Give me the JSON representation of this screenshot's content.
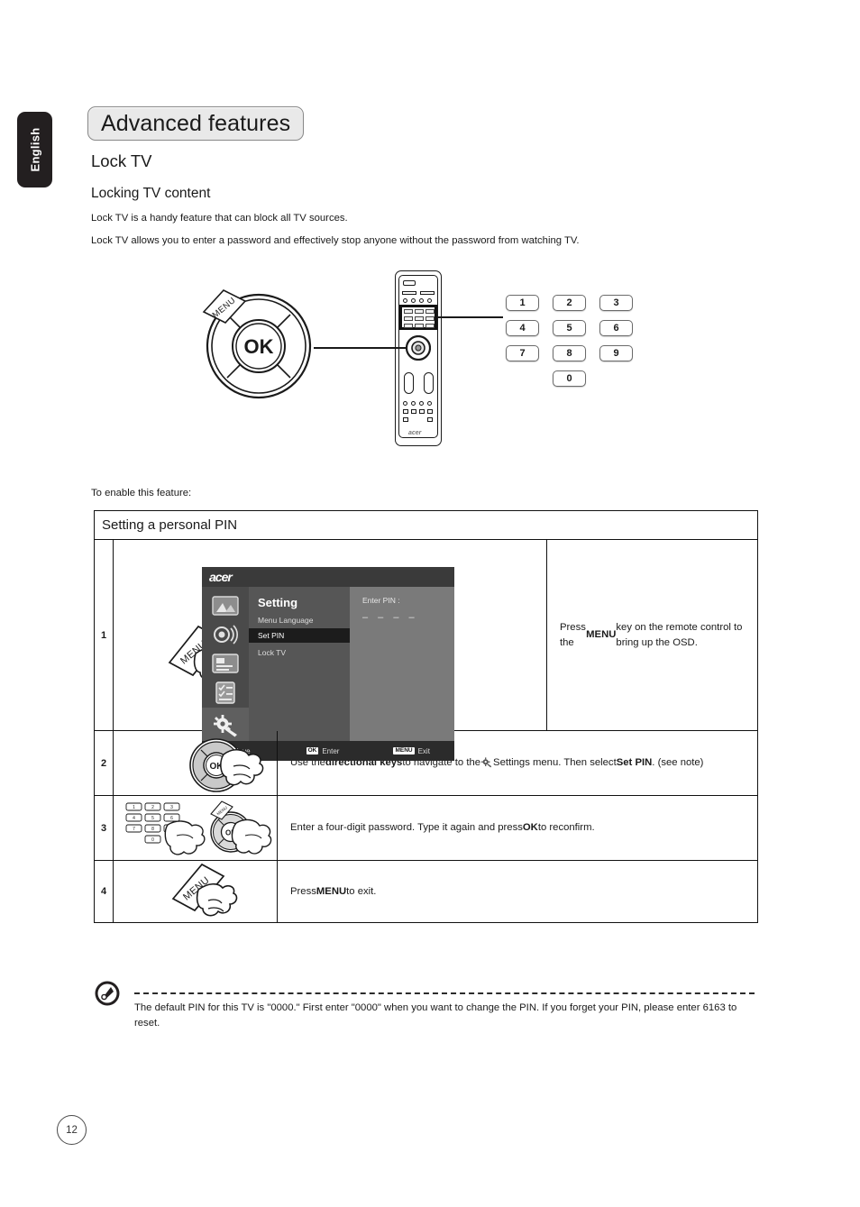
{
  "sidebar_tab": {
    "label": "English"
  },
  "heading": {
    "chip_title": "Advanced features",
    "h2": "Lock TV",
    "h3": "Locking TV content"
  },
  "intro": {
    "para1": "Lock TV is a handy feature that can block all TV sources.",
    "para2": "Lock TV allows you to enter a password and effectively stop anyone without the password from watching TV.",
    "enable_line": "To enable this feature:"
  },
  "hero_diagram": {
    "menu_tag_label": "MENU",
    "ok_label": "OK",
    "numpad_keys": [
      "1",
      "2",
      "3",
      "4",
      "5",
      "6",
      "7",
      "8",
      "9",
      "0"
    ]
  },
  "procedure": {
    "title": "Setting a personal PIN",
    "steps": [
      {
        "num": "1",
        "text_html": "Press the <b>MENU</b> key on the remote control to bring up the OSD.",
        "illustration": "hand-pressing-menu-key"
      },
      {
        "num": "2",
        "text_html": "Use the <b>directional keys</b> to navigate to the <span class=\"gear-inline\" data-name=\"settings-gear-icon\"><svg viewBox=\"0 0 20 20\" width=\"14\" height=\"13\"><g fill=\"#555\"><circle cx=\"8\" cy=\"8\" r=\"4.6\"/><circle cx=\"8\" cy=\"8\" r=\"1.8\" fill=\"#fff\"/><rect x=\"7\" y=\"0.6\" width=\"2\" height=\"3\"/><rect x=\"7\" y=\"12.4\" width=\"2\" height=\"3\"/><rect x=\"0.6\" y=\"7\" width=\"3\" height=\"2\"/><rect x=\"12.4\" y=\"7\" width=\"3\" height=\"2\"/><path d=\"M11.5 11 L18 15.5 L16.5 17.5 L10.5 12.5 Z\"/></g></svg></span> Settings menu. Then select <b>Set PIN</b>. (see note)",
        "illustration": "hand-pressing-ok-wheel"
      },
      {
        "num": "3",
        "text_html": "Enter a four-digit password. Type it again and press <b>OK</b> to reconfirm.",
        "illustration": "hand-pressing-numpad-and-ok"
      },
      {
        "num": "4",
        "text_html": "Press <b>MENU</b> to exit.",
        "illustration": "hand-pressing-menu-key"
      }
    ]
  },
  "osd": {
    "logo": "acer",
    "title": "Setting",
    "items": [
      "Menu Language",
      "Set PIN",
      "Lock TV"
    ],
    "selected_item": "Set PIN",
    "pin_label": "Enter PIN :",
    "pin_dashes": "–  –  –  –",
    "footer": [
      {
        "key": "nav",
        "label": "Move"
      },
      {
        "key": "OK",
        "label": "Enter"
      },
      {
        "key": "MENU",
        "label": "Exit"
      }
    ]
  },
  "note": {
    "icon": "acer-note-icon",
    "text": "The default PIN for this TV is \"0000.\" First enter \"0000\" when you want to change the PIN. If you forget your PIN, please enter 6163 to reset."
  },
  "footer": {
    "page_number": "12"
  },
  "colors": {
    "tab_bg": "#231f20",
    "chip_bg": "#e9e9e9",
    "osd_bg": "#6b6b6b",
    "osd_header": "#3a3a3a",
    "osd_highlight": "#1c1c1c",
    "ink": "#1a1a1a"
  }
}
